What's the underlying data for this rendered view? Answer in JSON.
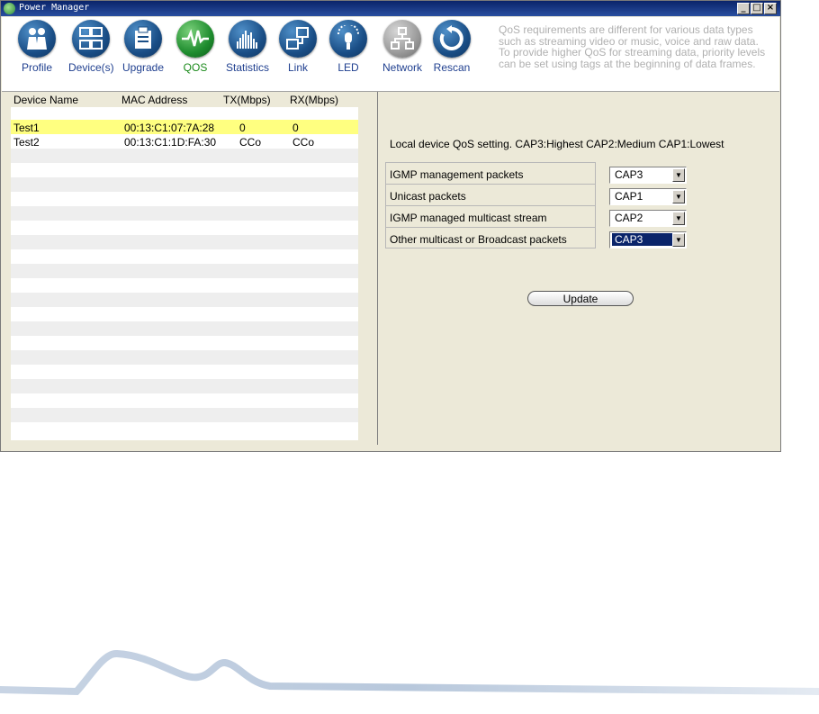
{
  "window": {
    "title": "Power Manager"
  },
  "toolbar": {
    "tools": [
      {
        "label": "Profile"
      },
      {
        "label": "Device(s)"
      },
      {
        "label": "Upgrade"
      },
      {
        "label": "QOS"
      },
      {
        "label": "Statistics"
      },
      {
        "label": "Link"
      },
      {
        "label": "LED"
      },
      {
        "label": "Network"
      },
      {
        "label": "Rescan"
      }
    ],
    "info": "QoS requirements are different for various data types such as streaming video or music, voice and raw data. To provide higher QoS for streaming data, priority levels can be set using tags at the beginning of data frames."
  },
  "device_list": {
    "headers": [
      "Device Name",
      "MAC Address",
      "TX(Mbps)",
      "RX(Mbps)"
    ],
    "rows": [
      {
        "name": "Test1",
        "mac": "00:13:C1:07:7A:28",
        "tx": "0",
        "rx": "0"
      },
      {
        "name": "Test2",
        "mac": "00:13:C1:1D:FA:30",
        "tx": "CCo",
        "rx": "CCo"
      }
    ]
  },
  "qos": {
    "title": "Local device QoS setting. CAP3:Highest CAP2:Medium CAP1:Lowest",
    "settings": [
      {
        "label": "IGMP management packets",
        "value": "CAP3"
      },
      {
        "label": "Unicast packets",
        "value": "CAP1"
      },
      {
        "label": "IGMP managed multicast stream",
        "value": "CAP2"
      },
      {
        "label": "Other multicast or Broadcast packets",
        "value": "CAP3"
      }
    ],
    "update_label": "Update"
  }
}
